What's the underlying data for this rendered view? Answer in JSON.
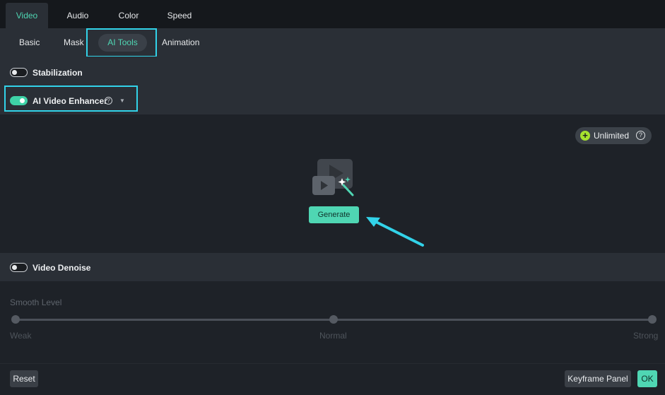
{
  "top_tabs": [
    {
      "label": "Video",
      "active": true
    },
    {
      "label": "Audio",
      "active": false
    },
    {
      "label": "Color",
      "active": false
    },
    {
      "label": "Speed",
      "active": false
    }
  ],
  "sub_tabs": [
    {
      "label": "Basic",
      "active": false
    },
    {
      "label": "Mask",
      "active": false
    },
    {
      "label": "AI Tools",
      "active": true
    },
    {
      "label": "Animation",
      "active": false
    }
  ],
  "stabilization": {
    "label": "Stabilization",
    "enabled": false
  },
  "ai_video_enhancer": {
    "label": "AI Video Enhancer",
    "enabled": true,
    "help_icon": "question-circle-icon",
    "dropdown_icon": "caret-down-icon",
    "badge": {
      "icon": "plus-circle-icon",
      "label": "Unlimited",
      "help_icon": "question-circle-icon"
    },
    "generate_icon": "video-magic-wand-icon",
    "generate_label": "Generate"
  },
  "video_denoise": {
    "label": "Video Denoise",
    "enabled": false,
    "smooth_level_label": "Smooth Level",
    "levels": [
      "Weak",
      "Normal",
      "Strong"
    ],
    "selected_level": "Normal"
  },
  "footer": {
    "reset_label": "Reset",
    "keyframe_panel_label": "Keyframe Panel",
    "ok_label": "OK"
  },
  "colors": {
    "accent": "#4fd6b3",
    "highlight_box": "#32d3e9",
    "unlimited_plus": "#a6e22e"
  }
}
